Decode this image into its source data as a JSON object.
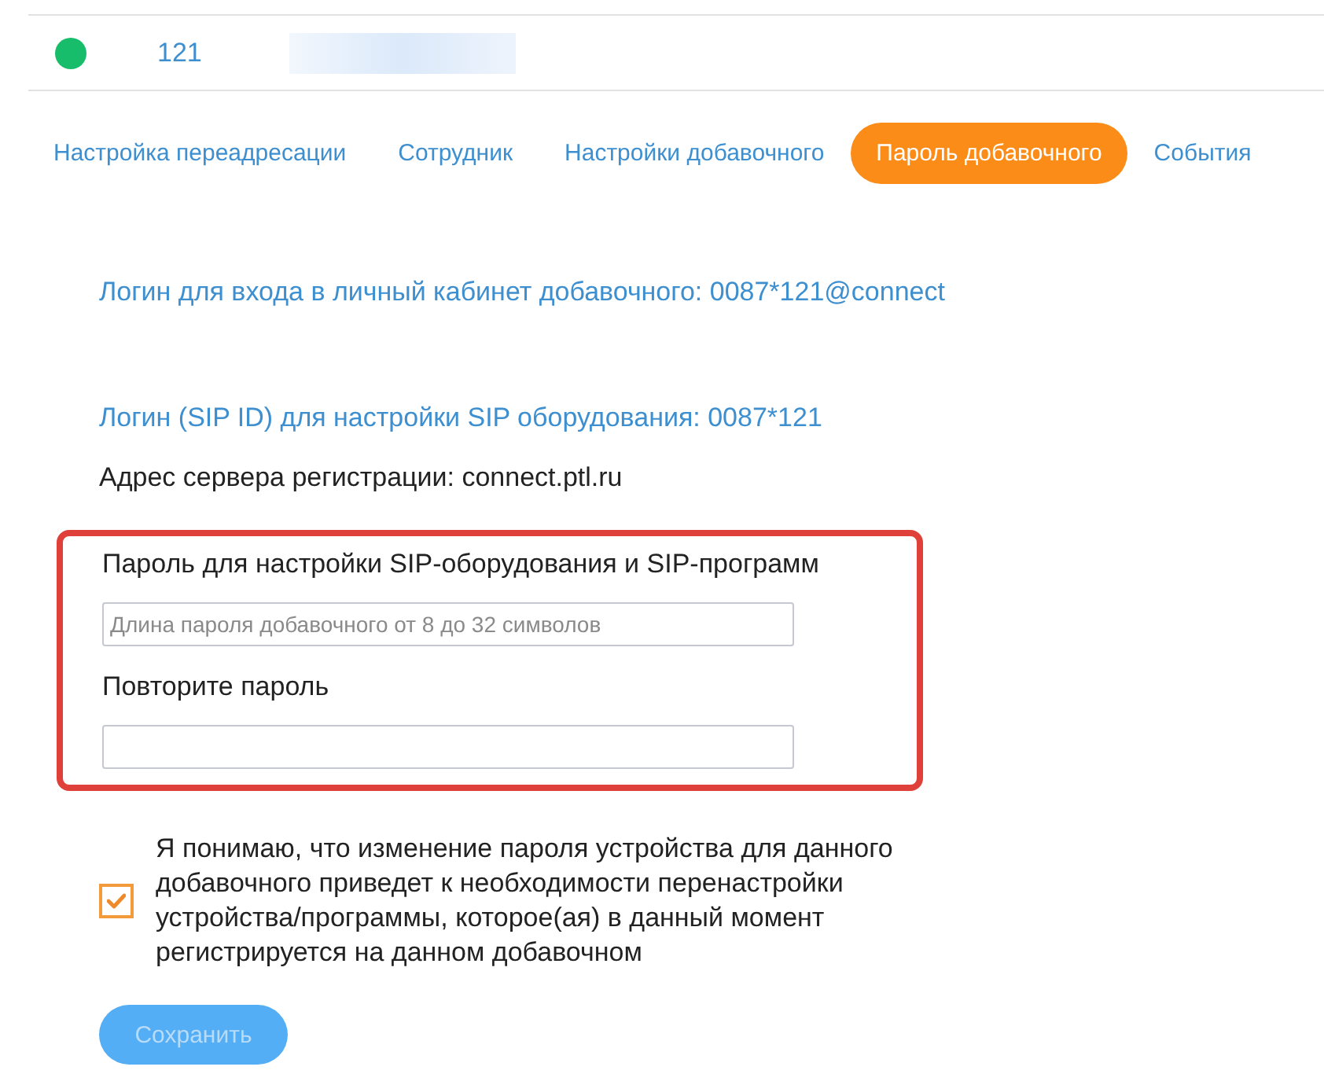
{
  "header": {
    "online": true,
    "extension": "121"
  },
  "tabs": [
    {
      "label": "Настройка переадресации",
      "selected": false
    },
    {
      "label": "Сотрудник",
      "selected": false
    },
    {
      "label": "Настройки добавочного",
      "selected": false
    },
    {
      "label": "Пароль добавочного",
      "selected": true
    },
    {
      "label": "События",
      "selected": false
    }
  ],
  "info": [
    {
      "kind": "link",
      "text": "Логин для входа в личный кабинет добавочного: 0087*121@connect"
    },
    {
      "kind": "link",
      "text": "Логин (SIP ID) для настройки SIP оборудования: 0087*121"
    },
    {
      "kind": "plain",
      "text": "Адрес сервера регистрации: connect.ptl.ru"
    }
  ],
  "password_form": {
    "highlighted": true,
    "fields": [
      {
        "label": "Пароль для настройки SIP-оборудования и SIP-программ",
        "placeholder": "Длина пароля добавочного от 8 до 32 символов"
      },
      {
        "label": "Повторите пароль"
      }
    ]
  },
  "consent": {
    "checked": true,
    "text": "Я понимаю, что изменение пароля устройства для данного добавочного приведет к необходимости перенастройки устройства/программы, которое(ая) в данный момент регистрируется на данном добавочном"
  },
  "save_button": {
    "label": "Сохранить",
    "disabled": true
  }
}
